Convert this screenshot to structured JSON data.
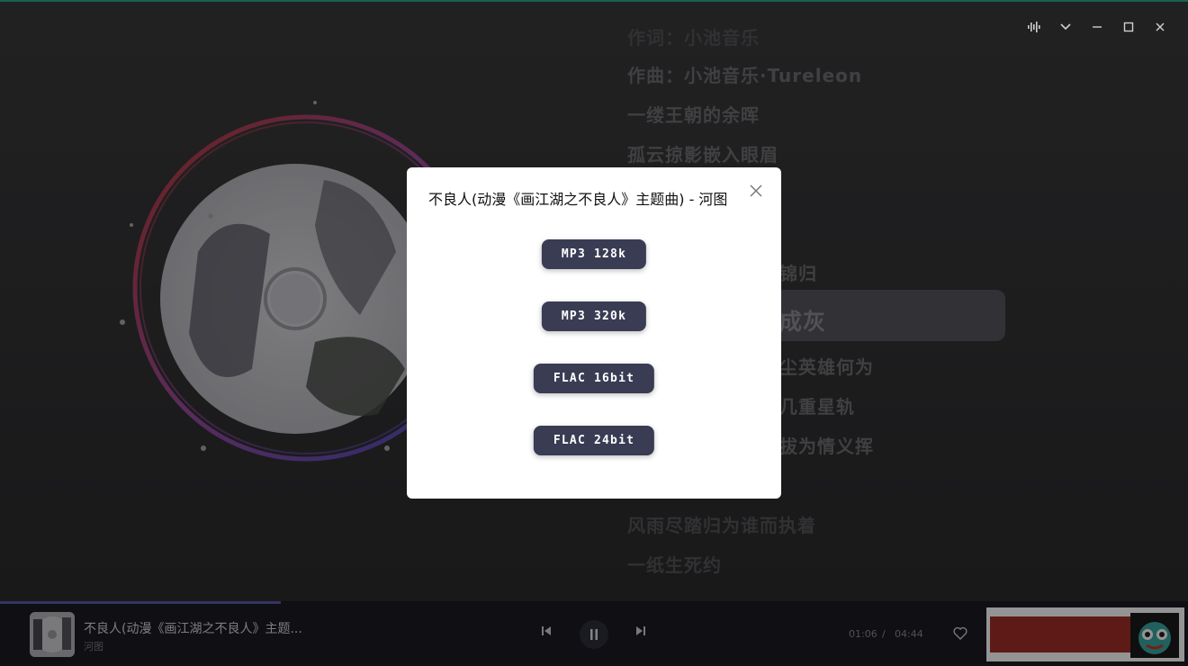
{
  "window": {
    "controls": [
      {
        "name": "audio-wave-icon",
        "glyph": "𝄃"
      },
      {
        "name": "chevron-down-icon",
        "glyph": "⌄"
      },
      {
        "name": "minimize-icon",
        "glyph": "—"
      },
      {
        "name": "maximize-icon",
        "glyph": "☐"
      },
      {
        "name": "close-icon",
        "glyph": "✕"
      }
    ]
  },
  "lyrics": {
    "lines": [
      "作词：小池音乐",
      "作曲：小池音乐·Tureleon",
      "一缕王朝的余晖",
      "孤云掠影嵌入眼眉",
      "锦归",
      "成灰",
      "尘英雄何为",
      "几重星轨",
      "拔为情义挥",
      "风雨尽踏归为谁而执着",
      "一纸生死约"
    ]
  },
  "modal": {
    "title": "不良人(动漫《画江湖之不良人》主题曲) - 河图",
    "options": [
      "MP3 128k",
      "MP3 320k",
      "FLAC 16bit",
      "FLAC 24bit"
    ]
  },
  "player": {
    "song_title": "不良人(动漫《画江湖之不良人》主题...",
    "artist": "河图",
    "current_time": "01:06",
    "separator": "/",
    "total_time": "04:44",
    "progress_fraction": 0.236
  },
  "colors": {
    "accent": "#5a5ab0",
    "modal_button": "#3a3c54",
    "bottom_bar": "#1a1b24"
  }
}
